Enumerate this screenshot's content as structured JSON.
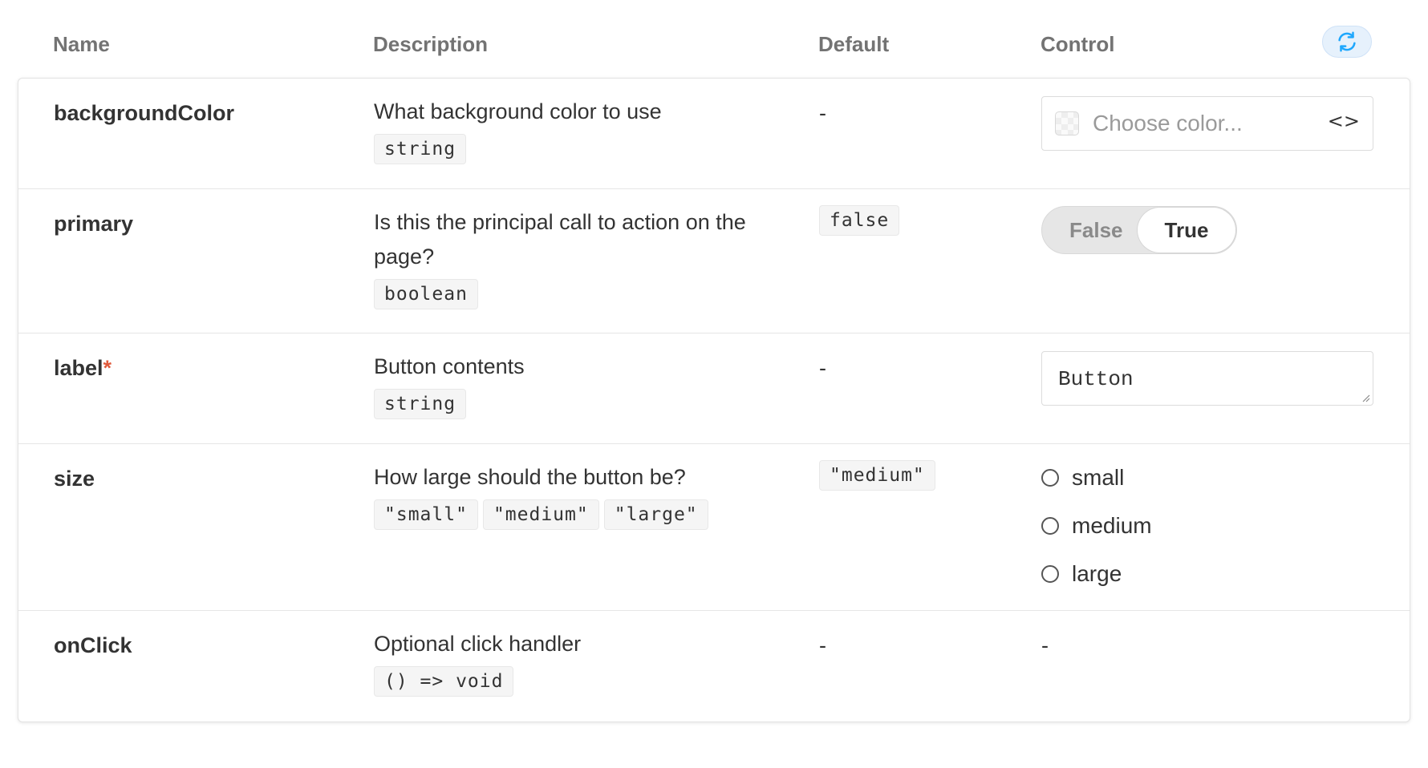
{
  "header": {
    "col_name": "Name",
    "col_description": "Description",
    "col_default": "Default",
    "col_control": "Control",
    "reset_icon": "sync-icon",
    "accent_color": "#1ea7fd"
  },
  "rows": [
    {
      "name": "backgroundColor",
      "description": "What background color to use",
      "types": [
        "string"
      ],
      "default": "-",
      "control": {
        "kind": "color",
        "placeholder": "Choose color...",
        "toggle_glyph": "<>"
      }
    },
    {
      "name": "primary",
      "description": "Is this the principal call to action on the page?",
      "types": [
        "boolean"
      ],
      "default": "false",
      "control": {
        "kind": "boolean",
        "false_label": "False",
        "true_label": "True",
        "selected": "True"
      }
    },
    {
      "name": "label",
      "required_marker": "*",
      "description": "Button contents",
      "types": [
        "string"
      ],
      "default": "-",
      "control": {
        "kind": "text",
        "value": "Button"
      }
    },
    {
      "name": "size",
      "description": "How large should the button be?",
      "types": [
        "\"small\"",
        "\"medium\"",
        "\"large\""
      ],
      "default": "\"medium\"",
      "control": {
        "kind": "radio",
        "options": [
          "small",
          "medium",
          "large"
        ]
      }
    },
    {
      "name": "onClick",
      "description": "Optional click handler",
      "types": [
        "() => void"
      ],
      "default": "-",
      "control": {
        "kind": "none",
        "text": "-"
      }
    }
  ]
}
